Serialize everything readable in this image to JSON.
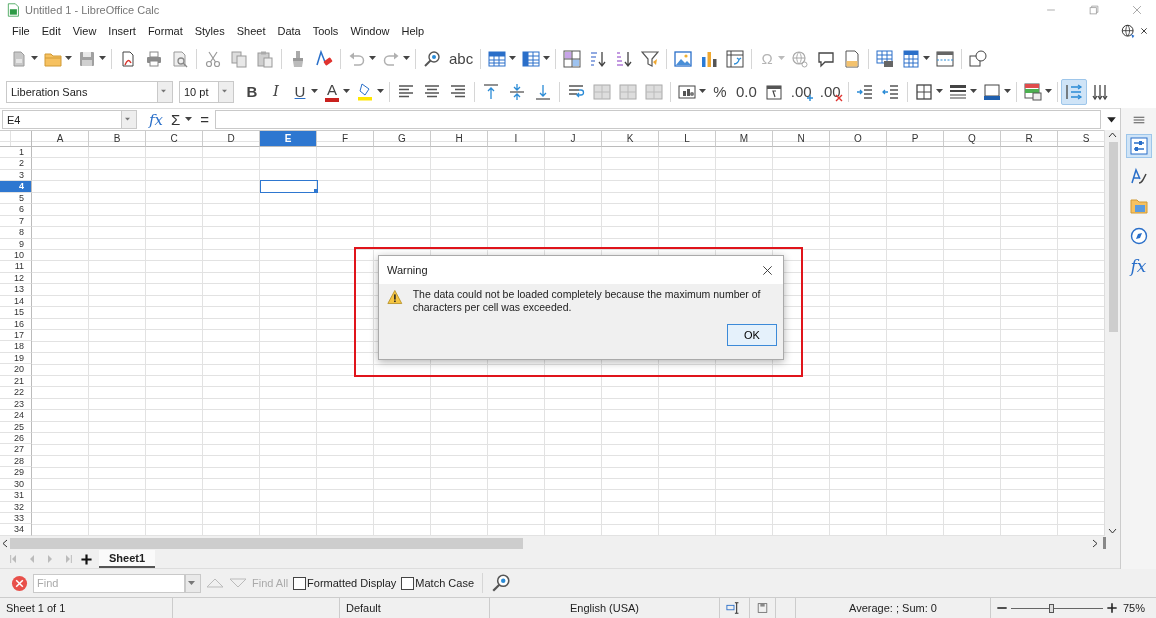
{
  "window": {
    "title": "Untitled 1 - LibreOffice Calc"
  },
  "menu": [
    "File",
    "Edit",
    "View",
    "Insert",
    "Format",
    "Styles",
    "Sheet",
    "Data",
    "Tools",
    "Window",
    "Help"
  ],
  "toolbars": [
    {
      "items": [
        {
          "kind": "icon",
          "dropdown": true,
          "selected": false
        },
        {
          "kind": "icon",
          "dropdown": true,
          "selected": false
        },
        {
          "kind": "icon",
          "dropdown": true,
          "selected": false
        },
        {
          "kind": "separator"
        },
        {
          "kind": "icon",
          "dropdown": false,
          "selected": false
        },
        {
          "kind": "icon",
          "dropdown": false,
          "selected": false
        },
        {
          "kind": "icon",
          "dropdown": false,
          "selected": false
        },
        {
          "kind": "separator"
        },
        {
          "kind": "icon",
          "dropdown": false,
          "selected": false
        },
        {
          "kind": "icon",
          "dropdown": false,
          "selected": false
        },
        {
          "kind": "icon",
          "dropdown": false,
          "selected": false
        },
        {
          "kind": "separator"
        },
        {
          "kind": "icon",
          "dropdown": false,
          "selected": false
        },
        {
          "kind": "icon",
          "dropdown": false,
          "selected": false
        },
        {
          "kind": "separator"
        },
        {
          "kind": "icon",
          "dropdown": true,
          "selected": false
        },
        {
          "kind": "icon",
          "dropdown": true,
          "selected": false
        },
        {
          "kind": "separator"
        },
        {
          "kind": "icon",
          "dropdown": false,
          "selected": false
        },
        {
          "kind": "glyph",
          "text": "abc",
          "dropdown": false,
          "selected": false,
          "disabled": false
        },
        {
          "kind": "separator"
        },
        {
          "kind": "icon",
          "dropdown": true,
          "selected": false
        },
        {
          "kind": "icon",
          "dropdown": true,
          "selected": false
        },
        {
          "kind": "separator"
        },
        {
          "kind": "icon",
          "dropdown": false,
          "selected": false
        },
        {
          "kind": "icon",
          "dropdown": false,
          "selected": false
        },
        {
          "kind": "icon",
          "dropdown": false,
          "selected": false
        },
        {
          "kind": "icon",
          "dropdown": false,
          "selected": false
        },
        {
          "kind": "separator"
        },
        {
          "kind": "icon",
          "dropdown": false,
          "selected": false
        },
        {
          "kind": "icon",
          "dropdown": false,
          "selected": false
        },
        {
          "kind": "icon",
          "dropdown": false,
          "selected": false
        },
        {
          "kind": "separator"
        },
        {
          "kind": "glyph",
          "text": "Ω",
          "dropdown": true,
          "selected": false,
          "disabled": true
        },
        {
          "kind": "icon",
          "dropdown": false,
          "selected": false
        },
        {
          "kind": "icon",
          "dropdown": false,
          "selected": false
        },
        {
          "kind": "icon",
          "dropdown": false,
          "selected": false
        },
        {
          "kind": "separator"
        },
        {
          "kind": "icon",
          "dropdown": false,
          "selected": false
        },
        {
          "kind": "icon",
          "dropdown": true,
          "selected": false
        },
        {
          "kind": "icon",
          "dropdown": false,
          "selected": false
        },
        {
          "kind": "separator"
        },
        {
          "kind": "icon",
          "dropdown": false,
          "selected": false
        }
      ]
    },
    {
      "font_name": {
        "value": "Liberation Sans"
      },
      "font_size": {
        "value": "10 pt"
      },
      "items": [
        {
          "kind": "glyph",
          "text": "B",
          "dropdown": false,
          "selected": false,
          "disabled": false
        },
        {
          "kind": "glyph",
          "text": "I",
          "dropdown": false,
          "selected": false,
          "disabled": false
        },
        {
          "kind": "glyph",
          "text": "U",
          "dropdown": true,
          "selected": false,
          "disabled": false
        },
        {
          "kind": "glyph",
          "text": "A",
          "dropdown": true,
          "selected": false,
          "disabled": false
        },
        {
          "kind": "icon",
          "dropdown": true,
          "selected": false
        },
        {
          "kind": "separator"
        },
        {
          "kind": "icon",
          "dropdown": false,
          "selected": false
        },
        {
          "kind": "icon",
          "dropdown": false,
          "selected": false
        },
        {
          "kind": "icon",
          "dropdown": false,
          "selected": false
        },
        {
          "kind": "separator"
        },
        {
          "kind": "icon",
          "dropdown": false,
          "selected": false
        },
        {
          "kind": "icon",
          "dropdown": false,
          "selected": false
        },
        {
          "kind": "icon",
          "dropdown": false,
          "selected": false
        },
        {
          "kind": "separator"
        },
        {
          "kind": "icon",
          "dropdown": false,
          "selected": false
        },
        {
          "kind": "icon",
          "dropdown": false,
          "selected": false
        },
        {
          "kind": "icon",
          "dropdown": false,
          "selected": false
        },
        {
          "kind": "icon",
          "dropdown": false,
          "selected": false
        },
        {
          "kind": "separator"
        },
        {
          "kind": "icon",
          "dropdown": true,
          "selected": false
        },
        {
          "kind": "glyph",
          "text": "%",
          "dropdown": false,
          "selected": false,
          "disabled": false
        },
        {
          "kind": "glyph",
          "text": "0.0",
          "dropdown": false,
          "selected": false,
          "disabled": false
        },
        {
          "kind": "icon",
          "dropdown": false,
          "selected": false
        },
        {
          "kind": "glyph",
          "text": ".00",
          "dropdown": false,
          "selected": false,
          "disabled": false
        },
        {
          "kind": "glyph",
          "text": ".00",
          "dropdown": false,
          "selected": false,
          "disabled": false
        },
        {
          "kind": "separator"
        },
        {
          "kind": "icon",
          "dropdown": false,
          "selected": false
        },
        {
          "kind": "icon",
          "dropdown": false,
          "selected": false
        },
        {
          "kind": "separator"
        },
        {
          "kind": "icon",
          "dropdown": true,
          "selected": false
        },
        {
          "kind": "icon",
          "dropdown": true,
          "selected": false
        },
        {
          "kind": "icon",
          "dropdown": true,
          "selected": false
        },
        {
          "kind": "separator"
        },
        {
          "kind": "icon",
          "dropdown": true,
          "selected": false
        },
        {
          "kind": "separator"
        },
        {
          "kind": "icon",
          "dropdown": false,
          "selected": true
        },
        {
          "kind": "icon",
          "dropdown": false,
          "selected": false
        }
      ]
    }
  ],
  "formula_bar": {
    "name_box": {
      "value": "E4"
    },
    "buttons": [
      {
        "text": "fx",
        "dropdown": false
      },
      {
        "text": "Σ",
        "dropdown": true
      },
      {
        "text": "=",
        "dropdown": false
      }
    ]
  },
  "columns": [
    {
      "label": "A",
      "selected": false
    },
    {
      "label": "B",
      "selected": false
    },
    {
      "label": "C",
      "selected": false
    },
    {
      "label": "D",
      "selected": false
    },
    {
      "label": "E",
      "selected": true
    },
    {
      "label": "F",
      "selected": false
    },
    {
      "label": "G",
      "selected": false
    },
    {
      "label": "H",
      "selected": false
    },
    {
      "label": "I",
      "selected": false
    },
    {
      "label": "J",
      "selected": false
    },
    {
      "label": "K",
      "selected": false
    },
    {
      "label": "L",
      "selected": false
    },
    {
      "label": "M",
      "selected": false
    },
    {
      "label": "N",
      "selected": false
    },
    {
      "label": "O",
      "selected": false
    },
    {
      "label": "P",
      "selected": false
    },
    {
      "label": "Q",
      "selected": false
    },
    {
      "label": "R",
      "selected": false
    },
    {
      "label": "S",
      "selected": false
    }
  ],
  "rows": [
    {
      "label": "1",
      "selected": false
    },
    {
      "label": "2",
      "selected": false
    },
    {
      "label": "3",
      "selected": false
    },
    {
      "label": "4",
      "selected": true
    },
    {
      "label": "5",
      "selected": false
    },
    {
      "label": "6",
      "selected": false
    },
    {
      "label": "7",
      "selected": false
    },
    {
      "label": "8",
      "selected": false
    },
    {
      "label": "9",
      "selected": false
    },
    {
      "label": "10",
      "selected": false
    },
    {
      "label": "11",
      "selected": false
    },
    {
      "label": "12",
      "selected": false
    },
    {
      "label": "13",
      "selected": false
    },
    {
      "label": "14",
      "selected": false
    },
    {
      "label": "15",
      "selected": false
    },
    {
      "label": "16",
      "selected": false
    },
    {
      "label": "17",
      "selected": false
    },
    {
      "label": "18",
      "selected": false
    },
    {
      "label": "19",
      "selected": false
    },
    {
      "label": "20",
      "selected": false
    },
    {
      "label": "21",
      "selected": false
    },
    {
      "label": "22",
      "selected": false
    },
    {
      "label": "23",
      "selected": false
    },
    {
      "label": "24",
      "selected": false
    },
    {
      "label": "25",
      "selected": false
    },
    {
      "label": "26",
      "selected": false
    },
    {
      "label": "27",
      "selected": false
    },
    {
      "label": "28",
      "selected": false
    },
    {
      "label": "29",
      "selected": false
    },
    {
      "label": "30",
      "selected": false
    },
    {
      "label": "31",
      "selected": false
    },
    {
      "label": "32",
      "selected": false
    },
    {
      "label": "33",
      "selected": false
    },
    {
      "label": "34",
      "selected": false
    }
  ],
  "dialog": {
    "title": "Warning",
    "message": "The data could not be loaded completely because the maximum number of characters per cell was exceeded.",
    "button": "OK"
  },
  "highlight_frame": {
    "color": "#e0141b"
  },
  "sidebar": {
    "items": [
      {
        "kind": "icon",
        "selected": true
      },
      {
        "kind": "icon",
        "selected": false
      },
      {
        "kind": "icon",
        "selected": false
      },
      {
        "kind": "icon",
        "selected": false
      },
      {
        "kind": "glyph",
        "text": "fx",
        "selected": false
      }
    ]
  },
  "sheet_tabs": [
    {
      "label": "Sheet1",
      "selected": true
    }
  ],
  "find_bar": {
    "placeholder": "Find",
    "find_all": {
      "label": "Find All",
      "disabled": true
    },
    "options": [
      {
        "label": "Formatted Display",
        "checked": false
      },
      {
        "label": "Match Case",
        "checked": false
      }
    ]
  },
  "status_bar": {
    "sheet": "Sheet 1 of 1",
    "page_style": "Default",
    "language": "English (USA)",
    "summary": "Average: ; Sum: 0",
    "zoom": {
      "level": 0.43,
      "reading": "75%"
    }
  }
}
